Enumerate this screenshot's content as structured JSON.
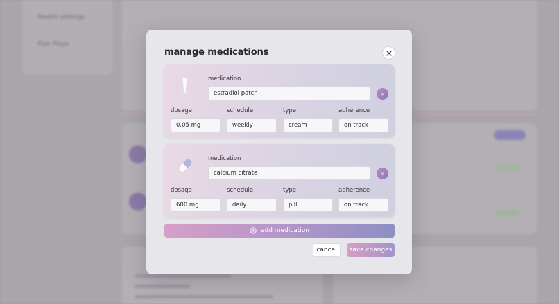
{
  "background": {
    "sidebar_items": [
      "Health settings",
      "Plan Plays"
    ]
  },
  "modal": {
    "title": "manage medications",
    "close_icon": "close-icon",
    "medications": [
      {
        "icon": "cream-tube-icon",
        "medication_label": "medication",
        "medication_value": "estradiol patch",
        "dosage_label": "dosage",
        "dosage_value": "0.05 mg",
        "schedule_label": "schedule",
        "schedule_value": "weekly",
        "type_label": "type",
        "type_value": "cream",
        "adherence_label": "adherence",
        "adherence_value": "on track",
        "remove_glyph": "×"
      },
      {
        "icon": "pill-capsule-icon",
        "medication_label": "medication",
        "medication_value": "calcium citrate",
        "dosage_label": "dosage",
        "dosage_value": "600 mg",
        "schedule_label": "schedule",
        "schedule_value": "daily",
        "type_label": "type",
        "type_value": "pill",
        "adherence_label": "adherence",
        "adherence_value": "on track",
        "remove_glyph": "×"
      }
    ],
    "add_label": "add medication",
    "cancel_label": "cancel",
    "save_label": "save changes"
  },
  "colors": {
    "accent_pink": "#d69fc7",
    "accent_purple": "#8d8fc5",
    "modal_bg": "#e7e6ea"
  }
}
